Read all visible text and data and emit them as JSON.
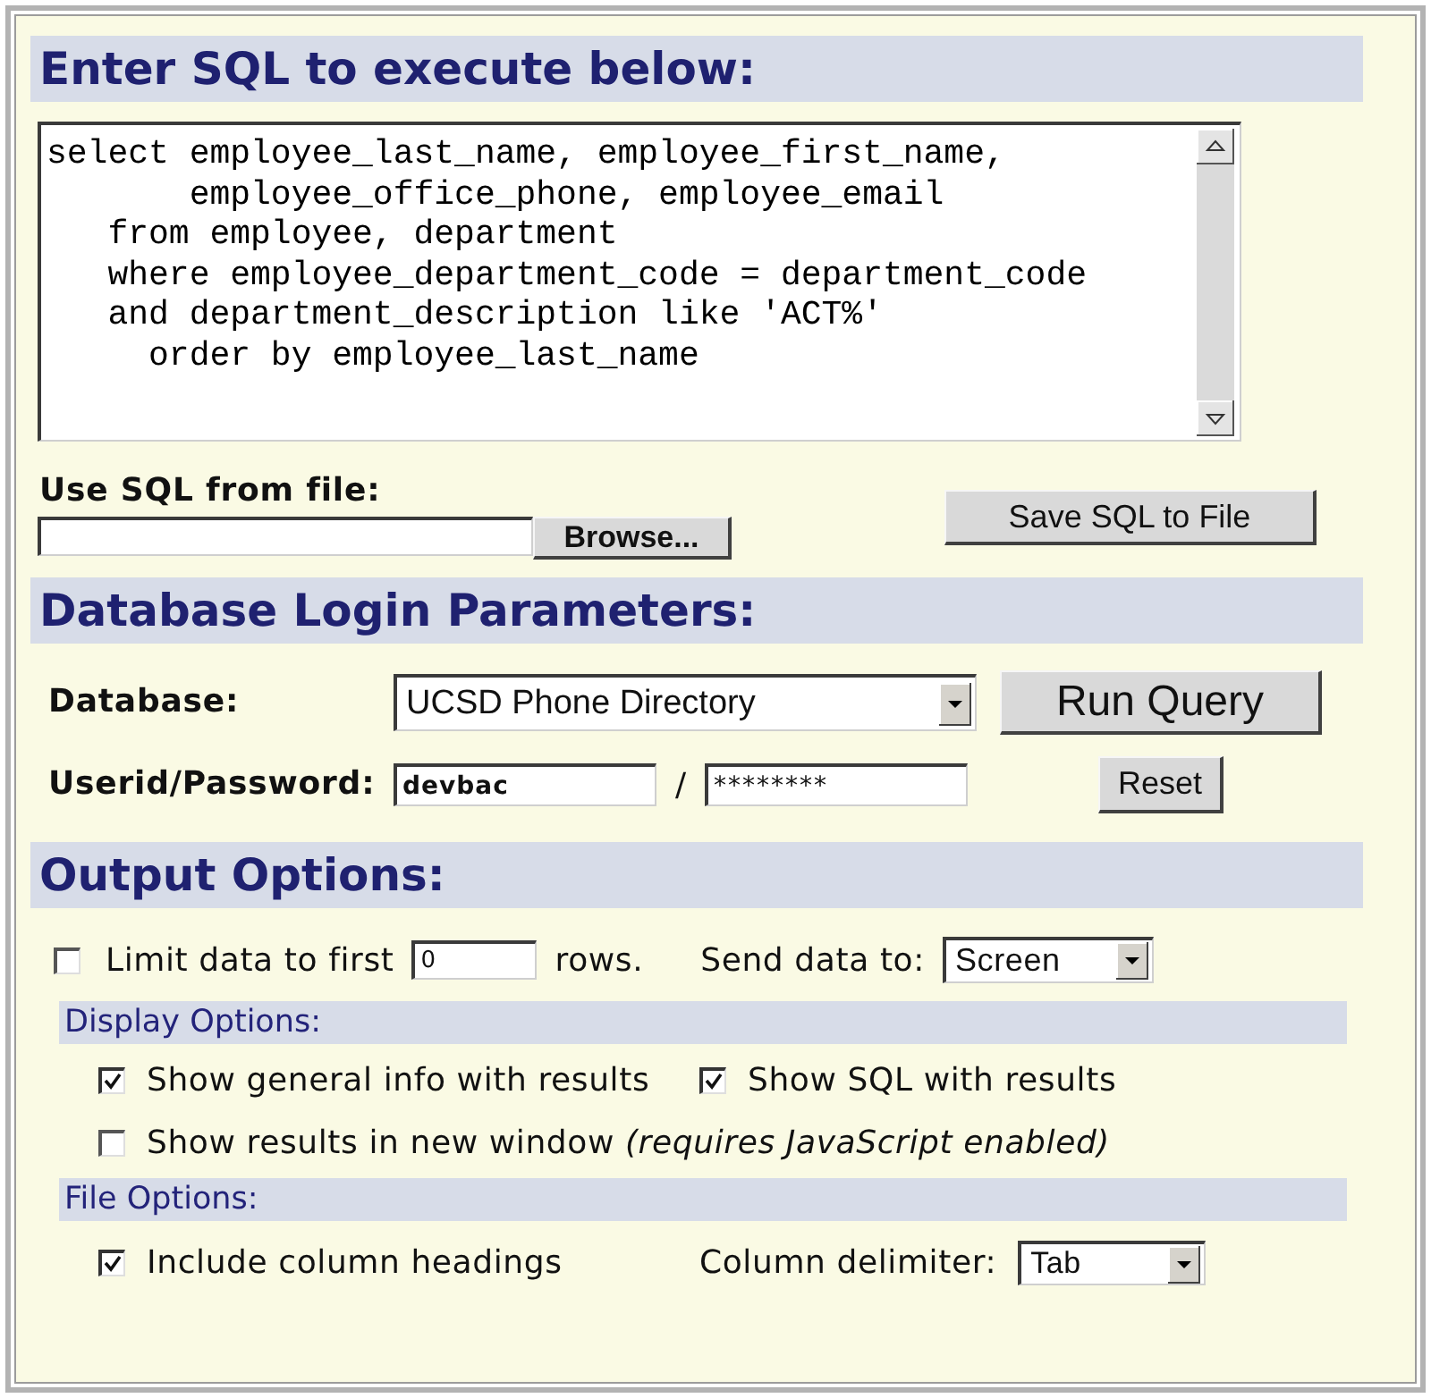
{
  "sql_section": {
    "heading": "Enter SQL to execute below:",
    "sql": "select employee_last_name, employee_first_name,\n       employee_office_phone, employee_email\n   from employee, department\n   where employee_department_code = department_code\n   and department_description like 'ACT%'\n     order by employee_last_name"
  },
  "file_section": {
    "label": "Use SQL from file:",
    "browse_button": "Browse...",
    "save_button": "Save SQL to File"
  },
  "login_section": {
    "heading": "Database Login Parameters:",
    "database": {
      "label": "Database:",
      "value": "UCSD Phone Directory"
    },
    "run_button": "Run Query",
    "credentials": {
      "label": "Userid/Password:",
      "userid": "devbac",
      "separator": "/",
      "password": "********"
    },
    "reset_button": "Reset"
  },
  "output_section": {
    "heading": "Output Options:",
    "limit": {
      "checked": false,
      "label": "Limit data to first",
      "value": "0",
      "suffix": "rows."
    },
    "send_to": {
      "label": "Send data to:",
      "value": "Screen"
    },
    "groups": [
      {
        "heading": "Display Options:",
        "rows": [
          [
            {
              "kind": "checkbox",
              "label": "Show general info with results",
              "checked": true
            },
            {
              "kind": "checkbox",
              "label": "Show SQL with results",
              "checked": true
            }
          ],
          [
            {
              "kind": "checkbox",
              "label": "Show results in new window *(requires JavaScript enabled)*",
              "checked": false
            }
          ]
        ]
      },
      {
        "heading": "File Options:",
        "rows": [
          [
            {
              "kind": "checkbox",
              "label": "Include column headings",
              "checked": true
            },
            {
              "kind": "select",
              "label": "Column delimiter:",
              "value": "Tab"
            }
          ]
        ]
      }
    ]
  }
}
